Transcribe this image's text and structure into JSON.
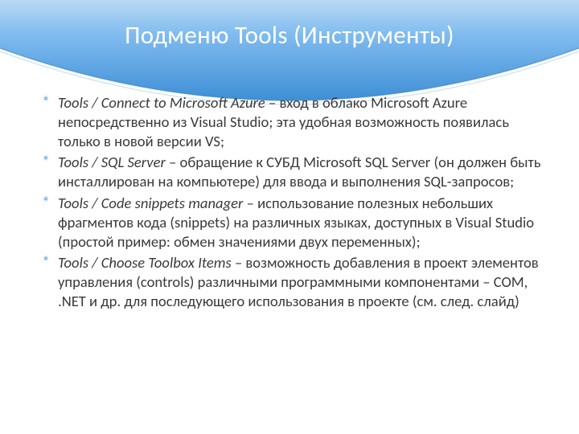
{
  "title": "Подменю Tools (Инструменты)",
  "items": [
    {
      "lead": "Tools / Connect to Microsoft Azure",
      "rest": " – вход в облако Microsoft Azure непосредственно из Visual Studio; эта удобная возможность появилась только в новой версии VS;"
    },
    {
      "lead": "Tools / SQL Server",
      "rest": " – обращение к СУБД Microsoft SQL Server (он должен быть инсталлирован на компьютере) для ввода и выполнения SQL-запросов;"
    },
    {
      "lead": "Tools / Code snippets manager",
      "rest": " – использование полезных небольших фрагментов кода (snippets) на различных языках, доступных в Visual Studio (простой пример: обмен значениями двух переменных);"
    },
    {
      "lead": "Tools / Choose Toolbox Items",
      "rest": " – возможность добавления в проект элементов управления (controls) различными программными компонентами – COM, .NET и др. для последующего использования в проекте (см. след. слайд)"
    }
  ]
}
